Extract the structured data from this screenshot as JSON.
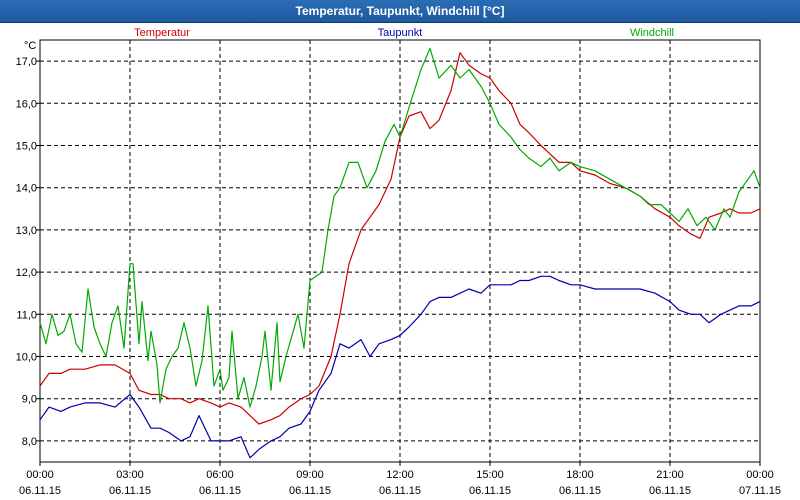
{
  "window": {
    "title": "Temperatur, Taupunkt, Windchill [°C]"
  },
  "chart_data": {
    "type": "line",
    "title": "Temperatur, Taupunkt, Windchill [°C]",
    "ylabel": "°C",
    "ylim": [
      7.5,
      17.5
    ],
    "xlim": [
      0,
      24
    ],
    "grid": true,
    "legend_position": "top",
    "y_ticks": [
      "8,0",
      "9,0",
      "10,0",
      "11,0",
      "12,0",
      "13,0",
      "14,0",
      "15,0",
      "16,0",
      "17,0"
    ],
    "x_ticks": [
      {
        "time": "00:00",
        "date": "06.11.15"
      },
      {
        "time": "03:00",
        "date": "06.11.15"
      },
      {
        "time": "06:00",
        "date": "06.11.15"
      },
      {
        "time": "09:00",
        "date": "06.11.15"
      },
      {
        "time": "12:00",
        "date": "06.11.15"
      },
      {
        "time": "15:00",
        "date": "06.11.15"
      },
      {
        "time": "18:00",
        "date": "06.11.15"
      },
      {
        "time": "21:00",
        "date": "06.11.15"
      },
      {
        "time": "00:00",
        "date": "07.11.15"
      }
    ],
    "series": [
      {
        "name": "Temperatur",
        "color": "#cc0000",
        "x": [
          0,
          0.3,
          0.7,
          1,
          1.5,
          2,
          2.5,
          3,
          3.3,
          3.7,
          4,
          4.3,
          4.7,
          5,
          5.3,
          5.7,
          6,
          6.3,
          6.7,
          7,
          7.3,
          7.7,
          8,
          8.3,
          8.7,
          9,
          9.3,
          9.7,
          10,
          10.3,
          10.7,
          11,
          11.3,
          11.7,
          12,
          12.3,
          12.7,
          13,
          13.3,
          13.7,
          14,
          14.3,
          14.7,
          15,
          15.3,
          15.7,
          16,
          16.3,
          16.7,
          17,
          17.3,
          17.7,
          18,
          18.5,
          19,
          19.5,
          20,
          20.5,
          21,
          21.3,
          21.7,
          22,
          22.3,
          22.7,
          23,
          23.3,
          23.7,
          24
        ],
        "y": [
          9.3,
          9.6,
          9.6,
          9.7,
          9.7,
          9.8,
          9.8,
          9.6,
          9.2,
          9.1,
          9.1,
          9.0,
          9.0,
          8.9,
          9.0,
          8.9,
          8.8,
          8.9,
          8.8,
          8.6,
          8.4,
          8.5,
          8.6,
          8.8,
          9.0,
          9.1,
          9.3,
          10.0,
          11.0,
          12.2,
          13.0,
          13.3,
          13.6,
          14.2,
          15.2,
          15.7,
          15.8,
          15.4,
          15.6,
          16.3,
          17.2,
          16.9,
          16.7,
          16.6,
          16.3,
          16.0,
          15.5,
          15.3,
          15.0,
          14.8,
          14.6,
          14.6,
          14.4,
          14.3,
          14.1,
          14.0,
          13.8,
          13.5,
          13.3,
          13.1,
          12.9,
          12.8,
          13.3,
          13.4,
          13.5,
          13.4,
          13.4,
          13.5
        ]
      },
      {
        "name": "Taupunkt",
        "color": "#0000aa",
        "x": [
          0,
          0.3,
          0.7,
          1,
          1.5,
          2,
          2.5,
          3,
          3.3,
          3.7,
          4,
          4.3,
          4.7,
          5,
          5.3,
          5.7,
          6,
          6.3,
          6.7,
          7,
          7.3,
          7.7,
          8,
          8.3,
          8.7,
          9,
          9.3,
          9.7,
          10,
          10.3,
          10.7,
          11,
          11.3,
          11.7,
          12,
          12.3,
          12.7,
          13,
          13.3,
          13.7,
          14,
          14.3,
          14.7,
          15,
          15.3,
          15.7,
          16,
          16.3,
          16.7,
          17,
          17.3,
          17.7,
          18,
          18.5,
          19,
          19.5,
          20,
          20.5,
          21,
          21.3,
          21.7,
          22,
          22.3,
          22.7,
          23,
          23.3,
          23.7,
          24
        ],
        "y": [
          8.5,
          8.8,
          8.7,
          8.8,
          8.9,
          8.9,
          8.8,
          9.1,
          8.8,
          8.3,
          8.3,
          8.2,
          8.0,
          8.1,
          8.6,
          8.0,
          8.0,
          8.0,
          8.1,
          7.6,
          7.8,
          8.0,
          8.1,
          8.3,
          8.4,
          8.7,
          9.2,
          9.6,
          10.3,
          10.2,
          10.4,
          10.0,
          10.3,
          10.4,
          10.5,
          10.7,
          11.0,
          11.3,
          11.4,
          11.4,
          11.5,
          11.6,
          11.5,
          11.7,
          11.7,
          11.7,
          11.8,
          11.8,
          11.9,
          11.9,
          11.8,
          11.7,
          11.7,
          11.6,
          11.6,
          11.6,
          11.6,
          11.5,
          11.3,
          11.1,
          11.0,
          11.0,
          10.8,
          11.0,
          11.1,
          11.2,
          11.2,
          11.3
        ]
      },
      {
        "name": "Windchill",
        "color": "#00aa00",
        "x": [
          0,
          0.2,
          0.4,
          0.6,
          0.8,
          1,
          1.2,
          1.4,
          1.6,
          1.8,
          2,
          2.2,
          2.4,
          2.6,
          2.8,
          3,
          3.1,
          3.3,
          3.4,
          3.6,
          3.7,
          3.9,
          4,
          4.2,
          4.4,
          4.6,
          4.8,
          5,
          5.2,
          5.4,
          5.6,
          5.8,
          6,
          6.1,
          6.3,
          6.4,
          6.6,
          6.8,
          7,
          7.2,
          7.4,
          7.5,
          7.7,
          7.9,
          8,
          8.2,
          8.4,
          8.6,
          8.8,
          9,
          9.2,
          9.4,
          9.6,
          9.8,
          10,
          10.3,
          10.6,
          10.9,
          11.2,
          11.5,
          11.8,
          12,
          12.3,
          12.7,
          13,
          13.3,
          13.7,
          14,
          14.3,
          14.7,
          15,
          15.3,
          15.7,
          16,
          16.3,
          16.7,
          17,
          17.3,
          17.7,
          18,
          18.5,
          19,
          19.5,
          20,
          20.3,
          20.7,
          21,
          21.3,
          21.6,
          21.9,
          22.2,
          22.5,
          22.8,
          23,
          23.3,
          23.6,
          23.8,
          24
        ],
        "y": [
          10.8,
          10.3,
          11.0,
          10.5,
          10.6,
          11.0,
          10.3,
          10.1,
          11.6,
          10.7,
          10.3,
          10.0,
          10.8,
          11.2,
          10.2,
          12.2,
          12.2,
          10.3,
          11.3,
          9.9,
          10.6,
          9.8,
          8.9,
          9.7,
          10.0,
          10.2,
          10.8,
          10.2,
          9.3,
          9.9,
          11.2,
          9.3,
          9.7,
          9.2,
          9.5,
          10.6,
          9.0,
          9.5,
          8.8,
          9.3,
          10.0,
          10.6,
          9.2,
          10.8,
          9.4,
          10.0,
          10.5,
          11.0,
          10.2,
          11.8,
          11.9,
          12.0,
          13.0,
          13.8,
          14.0,
          14.6,
          14.6,
          14.0,
          14.4,
          15.1,
          15.5,
          15.2,
          15.9,
          16.8,
          17.3,
          16.6,
          16.9,
          16.6,
          16.8,
          16.4,
          16.0,
          15.5,
          15.2,
          14.9,
          14.7,
          14.5,
          14.7,
          14.4,
          14.6,
          14.5,
          14.4,
          14.2,
          14.0,
          13.8,
          13.6,
          13.6,
          13.4,
          13.2,
          13.5,
          13.1,
          13.3,
          13.0,
          13.5,
          13.3,
          13.9,
          14.2,
          14.4,
          14.0
        ]
      }
    ]
  }
}
